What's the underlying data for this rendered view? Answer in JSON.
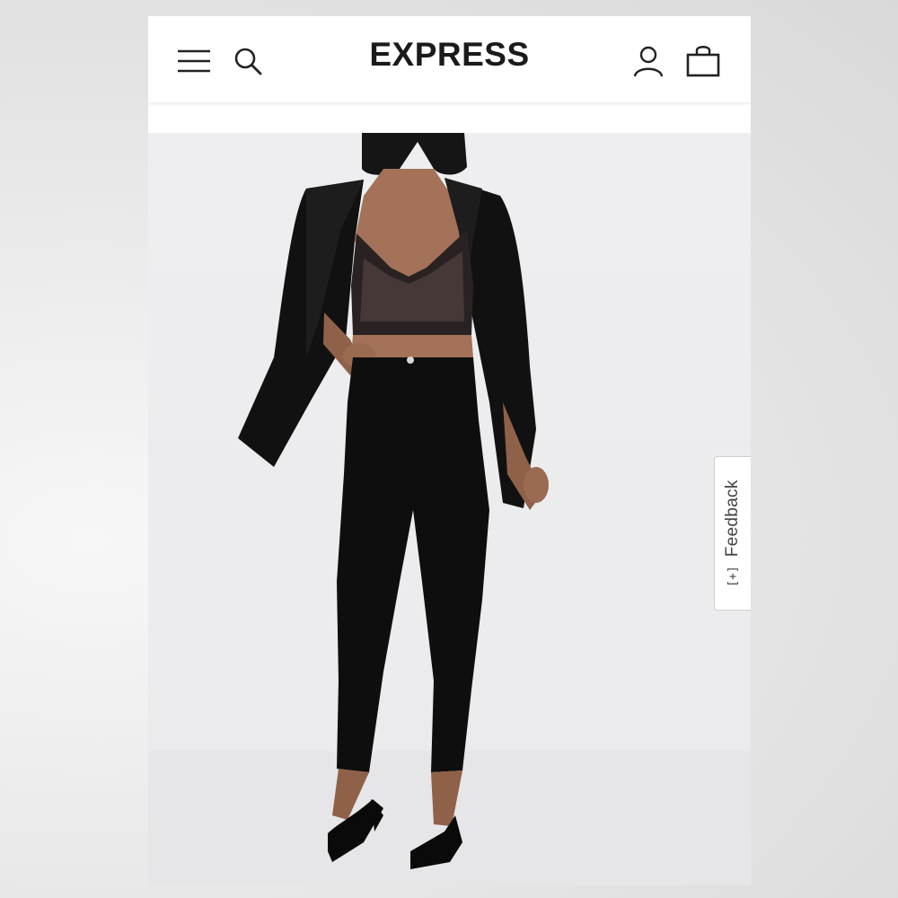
{
  "header": {
    "brand": "EXPRESS",
    "icons": {
      "menu": "hamburger-menu-icon",
      "search": "search-icon",
      "account": "account-icon",
      "bag": "shopping-bag-icon"
    }
  },
  "feedback": {
    "icon": "[+]",
    "label": "Feedback"
  },
  "colors": {
    "brand_text": "#1a1a1a",
    "header_bg": "#ffffff",
    "image_bg": "#ececee"
  }
}
